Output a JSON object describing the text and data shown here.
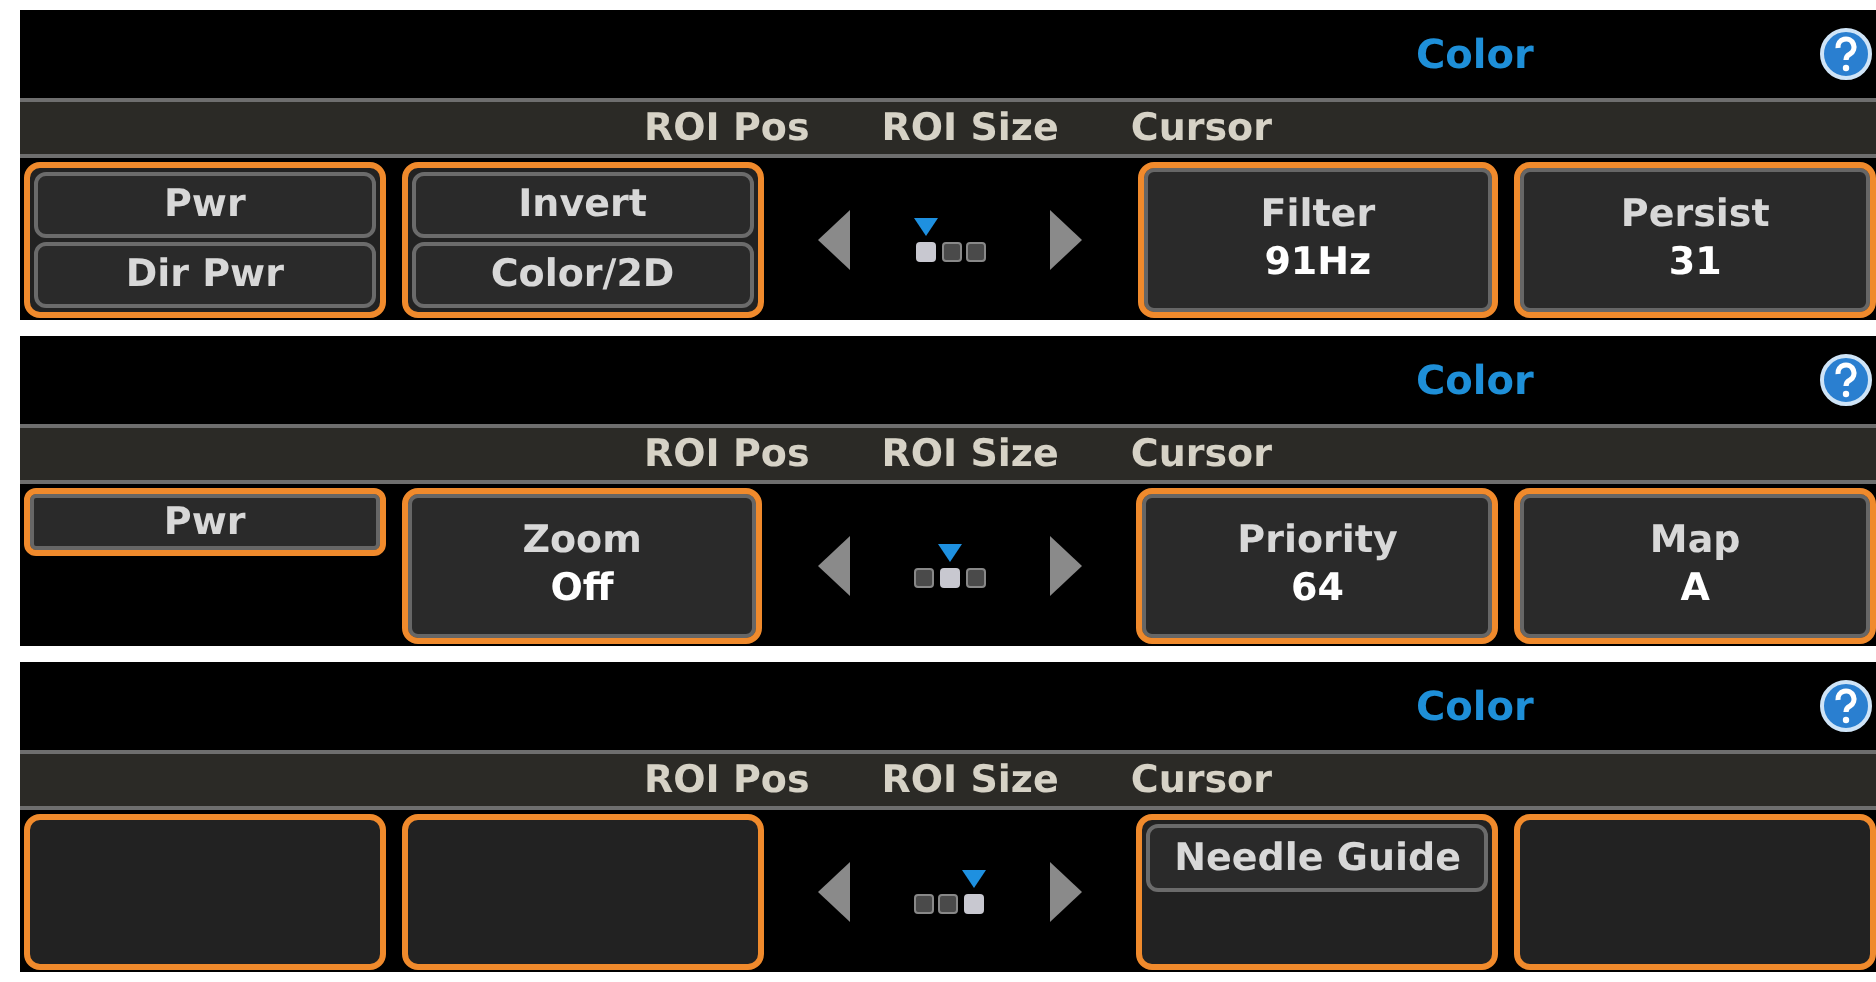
{
  "panels": [
    {
      "title": "Color",
      "tabs": [
        {
          "label": "ROI Pos"
        },
        {
          "label": "ROI Size"
        },
        {
          "label": "Cursor"
        }
      ],
      "slots": [
        {
          "kind": "pair",
          "buttons": [
            "Pwr",
            "Dir Pwr"
          ]
        },
        {
          "kind": "pair",
          "buttons": [
            "Invert",
            "Color/2D"
          ]
        },
        {
          "kind": "value",
          "label": "Filter",
          "value": "91Hz"
        },
        {
          "kind": "value",
          "label": "Persist",
          "value": "31"
        }
      ],
      "pages": [
        {
          "selected": true
        },
        {
          "selected": false
        },
        {
          "selected": false
        }
      ]
    },
    {
      "title": "Color",
      "tabs": [
        {
          "label": "ROI Pos"
        },
        {
          "label": "ROI Size"
        },
        {
          "label": "Cursor"
        }
      ],
      "slots": [
        {
          "kind": "lone",
          "label": "Pwr"
        },
        {
          "kind": "value",
          "label": "Zoom",
          "value": "Off"
        },
        {
          "kind": "value",
          "label": "Priority",
          "value": "64"
        },
        {
          "kind": "value",
          "label": "Map",
          "value": "A"
        }
      ],
      "pages": [
        {
          "selected": false
        },
        {
          "selected": true
        },
        {
          "selected": false
        }
      ]
    },
    {
      "title": "Color",
      "tabs": [
        {
          "label": "ROI Pos"
        },
        {
          "label": "ROI Size"
        },
        {
          "label": "Cursor"
        }
      ],
      "slots": [
        {
          "kind": "empty"
        },
        {
          "kind": "empty"
        },
        {
          "kind": "top",
          "label": "Needle Guide"
        },
        {
          "kind": "empty"
        }
      ],
      "pages": [
        {
          "selected": false
        },
        {
          "selected": false
        },
        {
          "selected": true
        }
      ]
    }
  ]
}
